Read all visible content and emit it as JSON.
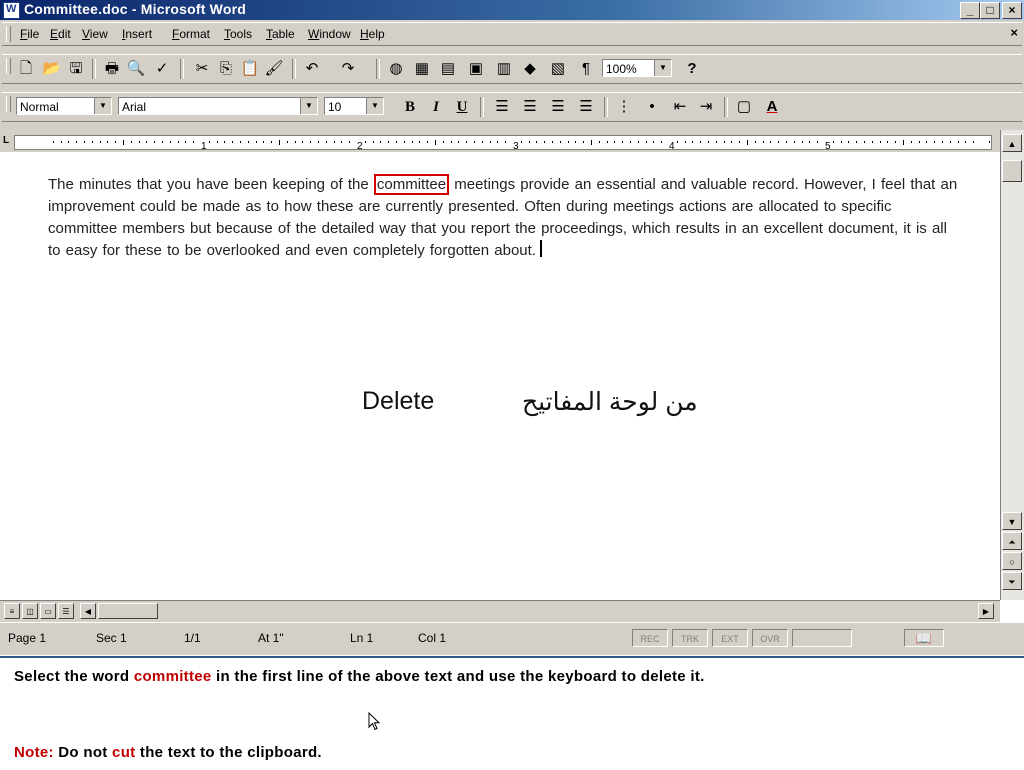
{
  "window": {
    "title": "Committee.doc - Microsoft Word",
    "controls": {
      "minimize": "_",
      "maximize": "□",
      "close": "×"
    }
  },
  "menubar": {
    "items": [
      "File",
      "Edit",
      "View",
      "Insert",
      "Format",
      "Tools",
      "Table",
      "Window",
      "Help"
    ],
    "doc_close": "×"
  },
  "toolbar_standard": {
    "zoom_value": "100%",
    "buttons": [
      "new-icon",
      "open-icon",
      "save-icon",
      "print-icon",
      "print-preview-icon",
      "spelling-icon",
      "cut-icon",
      "copy-icon",
      "paste-icon",
      "format-painter-icon",
      "undo-icon",
      "redo-icon",
      "web-toolbar-icon",
      "tables-borders-icon",
      "insert-table-icon",
      "insert-excel-icon",
      "columns-icon",
      "drawing-icon",
      "document-map-icon",
      "show-hide-icon",
      "help-icon"
    ],
    "show_hide_glyph": "¶",
    "help_glyph": "?"
  },
  "toolbar_formatting": {
    "style_value": "Normal",
    "font_value": "Arial",
    "size_value": "10",
    "bold_label": "B",
    "italic_label": "I",
    "underline_label": "U",
    "font_color_label": "A"
  },
  "ruler": {
    "numbers": [
      "1",
      "2",
      "3",
      "4",
      "5"
    ]
  },
  "document": {
    "before": "The minutes that you have been keeping of the ",
    "highlighted_word": "committee",
    "after": " meetings provide an essential and valuable record. However, I feel that an improvement could be made as to how these are currently presented. Often during meetings actions are allocated to specific committee members but because of the detailed way that you report the proceedings, which results in an excellent document, it is all to easy for these to be overlooked and even completely forgotten about."
  },
  "overlay": {
    "key_label": "Delete",
    "arabic_text": "من لوحة المفاتيح"
  },
  "statusbar": {
    "page": "Page 1",
    "sec": "Sec 1",
    "pages": "1/1",
    "at": "At 1\"",
    "ln": "Ln 1",
    "col": "Col 1",
    "modes": [
      "REC",
      "TRK",
      "EXT",
      "OVR"
    ]
  },
  "instruction": {
    "line1_a": "Select the word ",
    "line1_word": "committee",
    "line1_b": " in the first line of the above text and use the keyboard to delete it.",
    "note_label": "Note:",
    "note_a": " Do not ",
    "note_word": "cut",
    "note_b": " the text to the clipboard."
  },
  "colors": {
    "highlight_box": "#d40000",
    "instruction_red": "#c00000",
    "title_gradient_start": "#0a246a"
  }
}
